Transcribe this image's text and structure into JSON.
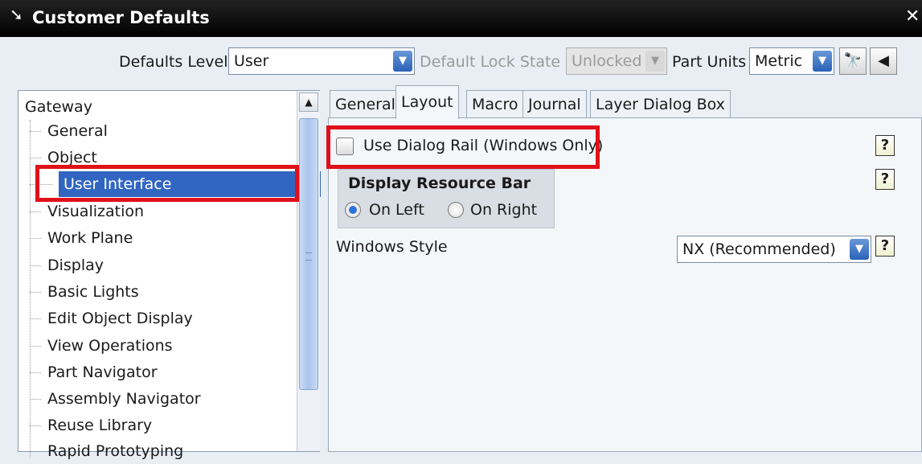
{
  "window": {
    "title": "Customer Defaults",
    "pin_icon": "pin-icon",
    "close_icon": "close-icon"
  },
  "toolbar": {
    "defaults_level_label": "Defaults Level",
    "defaults_level_value": "User",
    "lock_state_label": "Default Lock State",
    "lock_state_value": "Unlocked",
    "part_units_label": "Part Units",
    "part_units_value": "Metric",
    "find_icon": "binoculars-icon",
    "back_icon": "back-arrow-icon"
  },
  "tree": {
    "root": "Gateway",
    "items": [
      "General",
      "Object",
      "User Interface",
      "Visualization",
      "Work Plane",
      "Display",
      "Basic Lights",
      "Edit Object Display",
      "View Operations",
      "Part Navigator",
      "Assembly Navigator",
      "Reuse Library",
      "Rapid Prototyping"
    ],
    "selected": "User Interface"
  },
  "tabs": [
    {
      "label": "General",
      "active": false
    },
    {
      "label": "Layout",
      "active": true
    },
    {
      "label": "Macro",
      "active": false
    },
    {
      "label": "Journal",
      "active": false
    },
    {
      "label": "Layer Dialog Box",
      "active": false
    }
  ],
  "layout": {
    "dialog_rail_label": "Use Dialog Rail (Windows Only)",
    "dialog_rail_checked": false,
    "resource_bar_title": "Display Resource Bar",
    "on_left_label": "On Left",
    "on_right_label": "On Right",
    "selected_side": "On Left",
    "windows_style_label": "Windows Style",
    "windows_style_value": "NX (Recommended)",
    "help_glyph": "?"
  },
  "colors": {
    "highlight_red": "#e0101a",
    "selection_blue": "#3165c2"
  }
}
